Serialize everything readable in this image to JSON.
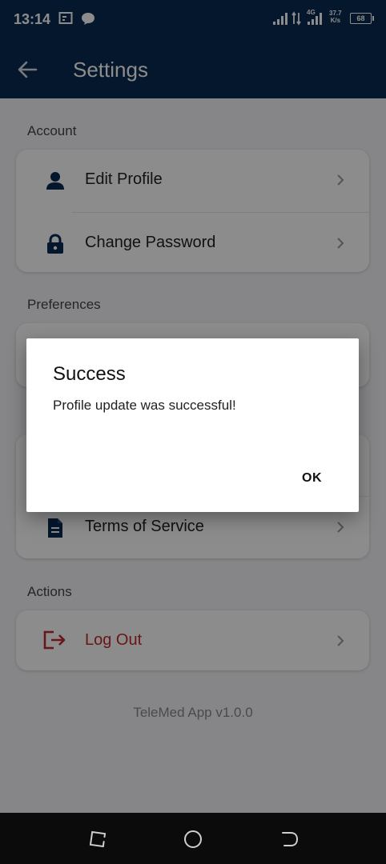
{
  "status_bar": {
    "time": "13:14",
    "network": "4G",
    "speed_value": "37.7",
    "speed_unit": "K/s",
    "battery": "68"
  },
  "app_bar": {
    "title": "Settings"
  },
  "sections": {
    "account": {
      "title": "Account",
      "items": [
        {
          "label": "Edit Profile",
          "icon": "person-icon"
        },
        {
          "label": "Change Password",
          "icon": "lock-icon"
        }
      ]
    },
    "preferences": {
      "title": "Preferences"
    },
    "legal": {
      "items": [
        {
          "label": "Terms of Service",
          "icon": "document-icon"
        }
      ]
    },
    "actions": {
      "title": "Actions",
      "items": [
        {
          "label": "Log Out",
          "icon": "logout-icon"
        }
      ]
    }
  },
  "version": "TeleMed App v1.0.0",
  "dialog": {
    "title": "Success",
    "message": "Profile update was successful!",
    "ok_label": "OK"
  },
  "colors": {
    "primary": "#0a2a52",
    "danger": "#c0282d",
    "icon": "#0a2a52"
  }
}
